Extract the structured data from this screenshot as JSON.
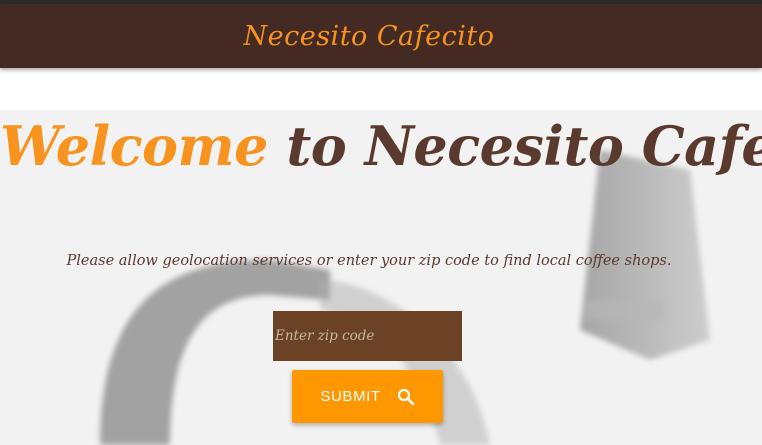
{
  "navbar": {
    "brand": "Necesito Cafecito"
  },
  "hero": {
    "headline_highlight": "Welcome",
    "headline_rest": " to Necesito Cafecito!",
    "instructions": "Please allow geolocation services or enter your zip code to find local coffee shops."
  },
  "search": {
    "placeholder": "Enter zip code",
    "value": "",
    "submit_label": "SUBMIT",
    "submit_icon": "search-icon"
  },
  "colors": {
    "navbar_bg": "#432a22",
    "accent_orange": "#f7931e",
    "heading_brown": "#5a3a2e",
    "input_bg": "#6b4226",
    "button_bg": "#ff9800"
  }
}
